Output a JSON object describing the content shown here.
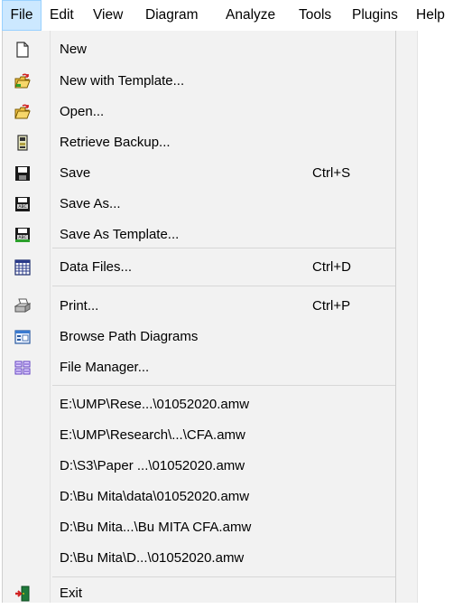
{
  "menubar": {
    "items": [
      "File",
      "Edit",
      "View",
      "Diagram",
      "Analyze",
      "Tools",
      "Plugins",
      "Help"
    ]
  },
  "file_menu": {
    "new": {
      "label": "New",
      "icon": "blank-document-icon"
    },
    "new_template": {
      "label": "New with Template...",
      "icon": "open-folder-arrow-icon"
    },
    "open": {
      "label": "Open...",
      "icon": "open-folder-icon"
    },
    "retrieve_backup": {
      "label": "Retrieve Backup...",
      "icon": "backup-file-icon"
    },
    "save": {
      "label": "Save",
      "shortcut": "Ctrl+S",
      "icon": "floppy-disk-icon"
    },
    "save_as": {
      "label": "Save As...",
      "icon": "floppy-disk-abc-icon"
    },
    "save_as_template": {
      "label": "Save As  Template...",
      "icon": "floppy-disk-template-icon"
    },
    "data_files": {
      "label": "Data Files...",
      "shortcut": "Ctrl+D",
      "icon": "data-grid-icon"
    },
    "print": {
      "label": "Print...",
      "shortcut": "Ctrl+P",
      "icon": "printer-icon"
    },
    "browse": {
      "label": "Browse Path Diagrams",
      "icon": "browse-window-icon"
    },
    "file_manager": {
      "label": "File Manager...",
      "icon": "file-manager-icon"
    },
    "recent": [
      "E:\\UMP\\Rese...\\01052020.amw",
      "E:\\UMP\\Research\\...\\CFA.amw",
      "D:\\S3\\Paper ...\\01052020.amw",
      "D:\\Bu Mita\\data\\01052020.amw",
      "D:\\Bu Mita...\\Bu MITA CFA.amw",
      "D:\\Bu Mita\\D...\\01052020.amw"
    ],
    "exit": {
      "label": "Exit",
      "icon": "exit-door-icon"
    }
  }
}
